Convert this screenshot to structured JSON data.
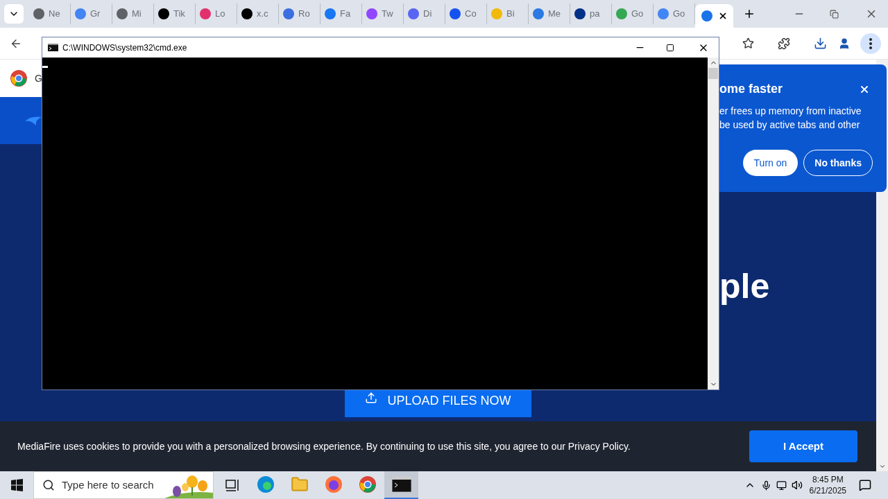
{
  "browser": {
    "tabs": [
      {
        "label": "Ne",
        "color": "#5f6368",
        "selected": false
      },
      {
        "label": "Gr",
        "color": "#4285f4",
        "selected": false
      },
      {
        "label": "Mi",
        "color": "#5f6368",
        "selected": false
      },
      {
        "label": "Tik",
        "color": "#000000",
        "selected": false
      },
      {
        "label": "Lo",
        "color": "#e1306c",
        "selected": false
      },
      {
        "label": "x.c",
        "color": "#000000",
        "selected": false
      },
      {
        "label": "Ro",
        "color": "#3b6fe0",
        "selected": false
      },
      {
        "label": "Fa",
        "color": "#1877f2",
        "selected": false
      },
      {
        "label": "Tw",
        "color": "#9146ff",
        "selected": false
      },
      {
        "label": "Di",
        "color": "#5865f2",
        "selected": false
      },
      {
        "label": "Co",
        "color": "#1652f0",
        "selected": false
      },
      {
        "label": "Bi",
        "color": "#f0b90b",
        "selected": false
      },
      {
        "label": "Me",
        "color": "#2a7ae2",
        "selected": false
      },
      {
        "label": "pa",
        "color": "#003087",
        "selected": false
      },
      {
        "label": "Go",
        "color": "#34a853",
        "selected": false
      },
      {
        "label": "Go",
        "color": "#4285f4",
        "selected": false
      },
      {
        "color": "#1a73e8",
        "selected": true
      }
    ],
    "infobar_text": "G",
    "promo": {
      "title": "ome faster",
      "body_lines": [
        "er frees up memory from inactive",
        "be used by active tabs and other"
      ],
      "buttons": [
        "Turn on",
        "No thanks"
      ]
    },
    "page": {
      "headline": "ple",
      "upload_button": "UPLOAD FILES NOW",
      "cookie_text": "MediaFire uses cookies to provide you with a personalized browsing experience. By continuing to use this site, you agree to our Privacy Policy.",
      "accept_button": "I Accept"
    }
  },
  "console": {
    "title": "C:\\WINDOWS\\system32\\cmd.exe"
  },
  "taskbar": {
    "search_placeholder": "Type here to search",
    "apps": [
      {
        "kind": "edge",
        "selected": false
      },
      {
        "kind": "explorer",
        "selected": false
      },
      {
        "kind": "firefox",
        "selected": false
      },
      {
        "kind": "chrome",
        "selected": false
      },
      {
        "kind": "console",
        "selected": true
      }
    ],
    "time": "8:45 PM",
    "date": "6/21/2025"
  }
}
